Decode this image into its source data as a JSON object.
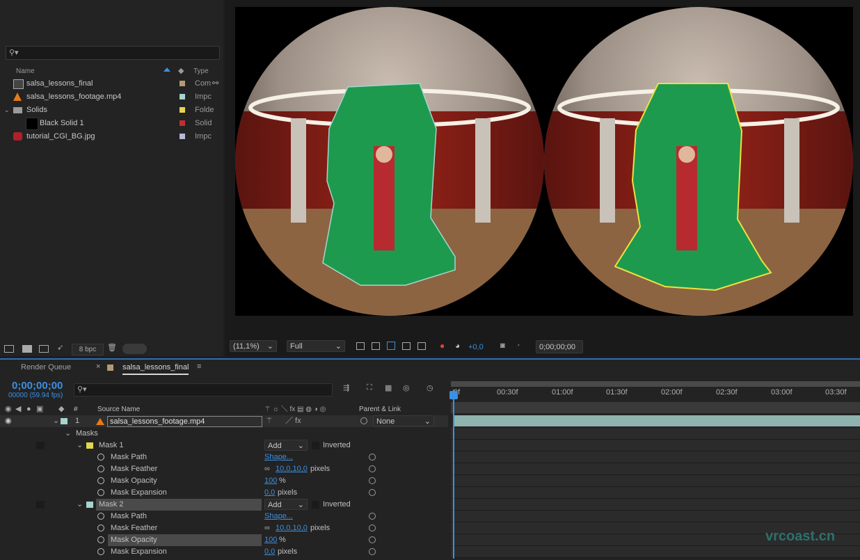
{
  "project": {
    "columns": {
      "name": "Name",
      "type": "Type"
    },
    "items": [
      {
        "name": "salsa_lessons_final",
        "type": "Com",
        "color": "#b49a74"
      },
      {
        "name": "salsa_lessons_footage.mp4",
        "type": "Impc",
        "color": "#a6d4d0"
      },
      {
        "name": "Solids",
        "type": "Folde",
        "color": "#e3d64f"
      },
      {
        "name": "Black Solid 1",
        "type": "Solid",
        "color": "#c03030"
      },
      {
        "name": "tutorial_CGI_BG.jpg",
        "type": "Impc",
        "color": "#b6b8d6"
      }
    ],
    "bpc": "8 bpc"
  },
  "viewer": {
    "zoom": "(11,1%)",
    "resolution": "Full",
    "exposure": "+0,0",
    "timecode": "0;00;00;00"
  },
  "timeline": {
    "tabs": {
      "render_queue": "Render Queue",
      "comp": "salsa_lessons_final"
    },
    "current_time": "0;00;00;00",
    "frame_info": "00000 (59.94 fps)",
    "col_num": "#",
    "col_source": "Source Name",
    "col_parent": "Parent & Link",
    "ruler": [
      "0f",
      "00:30f",
      "01:00f",
      "01:30f",
      "02:00f",
      "02:30f",
      "03:00f",
      "03:30f"
    ],
    "layer": {
      "index": "1",
      "name": "salsa_lessons_footage.mp4",
      "parent": "None"
    },
    "masks_label": "Masks",
    "mask1": {
      "name": "Mask 1",
      "mode": "Add",
      "inverted": "Inverted",
      "props": [
        {
          "name": "Mask Path",
          "value": "Shape...",
          "unit": ""
        },
        {
          "name": "Mask Feather",
          "value": "10,0,10,0",
          "unit": "pixels"
        },
        {
          "name": "Mask Opacity",
          "value": "100",
          "unit": "%"
        },
        {
          "name": "Mask Expansion",
          "value": "0,0",
          "unit": "pixels"
        }
      ]
    },
    "mask2": {
      "name": "Mask 2",
      "mode": "Add",
      "inverted": "Inverted",
      "props": [
        {
          "name": "Mask Path",
          "value": "Shape...",
          "unit": ""
        },
        {
          "name": "Mask Feather",
          "value": "10,0,10,0",
          "unit": "pixels"
        },
        {
          "name": "Mask Opacity",
          "value": "100",
          "unit": "%"
        },
        {
          "name": "Mask Expansion",
          "value": "0,0",
          "unit": "pixels"
        }
      ]
    }
  },
  "watermark": "vrcoast.cn",
  "colors": {
    "accent": "#2d6fb3",
    "mask1": "#e3d64f",
    "mask2": "#a6d4d0"
  }
}
